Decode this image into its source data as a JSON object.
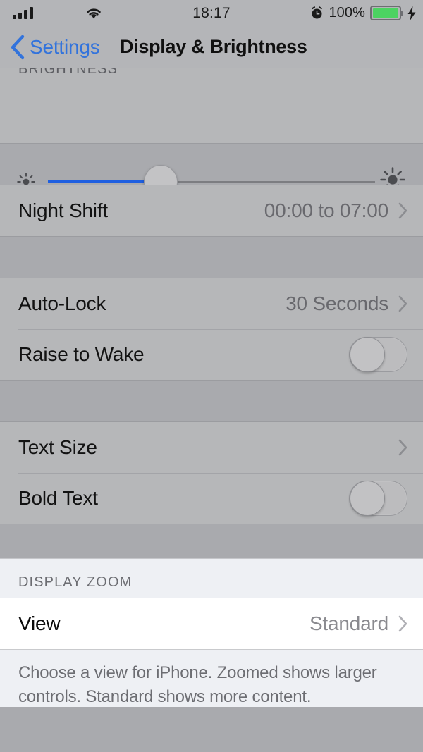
{
  "status_bar": {
    "signal_icon": "cellular-signal-icon",
    "wifi_icon": "wifi-icon",
    "time": "18:17",
    "alarm_icon": "alarm-clock-icon",
    "battery_percent": "100%",
    "battery_icon": "battery-full-icon",
    "charging_icon": "lightning-bolt-icon",
    "battery_color": "#4cd362"
  },
  "nav": {
    "back_icon": "chevron-left-icon",
    "back_label": "Settings",
    "title": "Display & Brightness",
    "accent_color": "#3273dc"
  },
  "brightness": {
    "header": "BRIGHTNESS",
    "low_icon": "sun-low-icon",
    "high_icon": "sun-high-icon",
    "slider_name": "brightness-slider",
    "value_percent": 30,
    "fill_color": "#1f5fe0"
  },
  "rows": {
    "night_shift": {
      "label": "Night Shift",
      "value": "00:00 to 07:00",
      "chevron": "chevron-right-icon"
    },
    "auto_lock": {
      "label": "Auto-Lock",
      "value": "30 Seconds",
      "chevron": "chevron-right-icon"
    },
    "raise_to_wake": {
      "label": "Raise to Wake",
      "toggle_state": "off"
    },
    "text_size": {
      "label": "Text Size",
      "chevron": "chevron-right-icon"
    },
    "bold_text": {
      "label": "Bold Text",
      "toggle_state": "off"
    }
  },
  "display_zoom": {
    "header": "DISPLAY ZOOM",
    "view": {
      "label": "View",
      "value": "Standard",
      "chevron": "chevron-right-icon"
    },
    "footer": "Choose a view for iPhone. Zoomed shows larger controls. Standard shows more content."
  }
}
